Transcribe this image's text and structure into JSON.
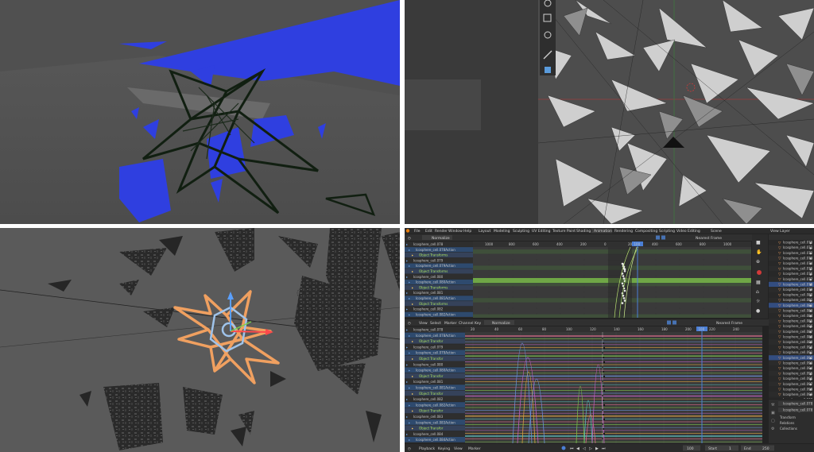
{
  "menu": [
    "File",
    "Edit",
    "Render",
    "Window",
    "Help"
  ],
  "workspaces": [
    "Layout",
    "Modeling",
    "Sculpting",
    "UV Editing",
    "Texture Paint",
    "Shading",
    "Animation",
    "Rendering",
    "Compositing",
    "Scripting",
    "Video Editing"
  ],
  "active_workspace": "Animation",
  "scene_name": "Scene",
  "view_layer": "View Layer",
  "normalize_label": "Normalize",
  "nearest_frame": "Nearest Frame",
  "graph_menu": [
    "View",
    "Select",
    "Marker",
    "Channel",
    "Key"
  ],
  "current_frame": "100",
  "dope_ticks": [
    "1000",
    "800",
    "600",
    "400",
    "200",
    "0",
    "200",
    "400",
    "600",
    "800",
    "1000"
  ],
  "graph_ticks": [
    "20",
    "40",
    "60",
    "80",
    "100",
    "120",
    "140",
    "160",
    "180",
    "200",
    "220",
    "240"
  ],
  "dope_channels": [
    {
      "label": "Icosphere_cell.078",
      "kind": "obj"
    },
    {
      "label": "Icosphere_cell.078Action",
      "kind": "act"
    },
    {
      "label": "Object Transforms",
      "kind": "grp"
    },
    {
      "label": "Icosphere_cell.079",
      "kind": "obj"
    },
    {
      "label": "Icosphere_cell.079Action",
      "kind": "act"
    },
    {
      "label": "Object Transforms",
      "kind": "grp"
    },
    {
      "label": "Icosphere_cell.080",
      "kind": "obj"
    },
    {
      "label": "Icosphere_cell.080Action",
      "kind": "act"
    },
    {
      "label": "Object Transforms",
      "kind": "grp"
    },
    {
      "label": "Icosphere_cell.081",
      "kind": "obj"
    },
    {
      "label": "Icosphere_cell.081Action",
      "kind": "act"
    },
    {
      "label": "Object Transforms",
      "kind": "grp"
    },
    {
      "label": "Icosphere_cell.082",
      "kind": "obj"
    },
    {
      "label": "Icosphere_cell.082Action",
      "kind": "act"
    }
  ],
  "graph_channels": [
    {
      "label": "Icosphere_cell.078",
      "kind": "obj"
    },
    {
      "label": "Icosphere_cell.078Action",
      "kind": "act"
    },
    {
      "label": "Object Transfor",
      "kind": "grp"
    },
    {
      "label": "Icosphere_cell.079",
      "kind": "obj"
    },
    {
      "label": "Icosphere_cell.079Action",
      "kind": "act"
    },
    {
      "label": "Object Transfor",
      "kind": "grp"
    },
    {
      "label": "Icosphere_cell.080",
      "kind": "obj"
    },
    {
      "label": "Icosphere_cell.080Action",
      "kind": "act"
    },
    {
      "label": "Object Transfor",
      "kind": "grp"
    },
    {
      "label": "Icosphere_cell.081",
      "kind": "obj"
    },
    {
      "label": "Icosphere_cell.081Action",
      "kind": "act"
    },
    {
      "label": "Object Transfor",
      "kind": "grp"
    },
    {
      "label": "Icosphere_cell.082",
      "kind": "obj"
    },
    {
      "label": "Icosphere_cell.082Action",
      "kind": "act"
    },
    {
      "label": "Object Transfor",
      "kind": "grp"
    },
    {
      "label": "Icosphere_cell.083",
      "kind": "obj"
    },
    {
      "label": "Icosphere_cell.083Action",
      "kind": "act"
    },
    {
      "label": "Object Transfor",
      "kind": "grp"
    },
    {
      "label": "Icosphere_cell.084",
      "kind": "obj"
    },
    {
      "label": "Icosphere_cell.084Action",
      "kind": "act"
    }
  ],
  "outliner_items": [
    "Icosphere_cell.070",
    "Icosphere_cell.071",
    "Icosphere_cell.072",
    "Icosphere_cell.073",
    "Icosphere_cell.074",
    "Icosphere_cell.075",
    "Icosphere_cell.076",
    "Icosphere_cell.077",
    "Icosphere_cell.078",
    "Icosphere_cell.079",
    "Icosphere_cell.080",
    "Icosphere_cell.081",
    "Icosphere_cell.082",
    "Icosphere_cell.083",
    "Icosphere_cell.084",
    "Icosphere_cell.085",
    "Icosphere_cell.086",
    "Icosphere_cell.087",
    "Icosphere_cell.088",
    "Icosphere_cell.089",
    "Icosphere_cell.090",
    "Icosphere_cell.091",
    "Icosphere_cell.092",
    "Icosphere_cell.093",
    "Icosphere_cell.094",
    "Icosphere_cell.095",
    "Icosphere_cell.096",
    "Icosphere_cell.097",
    "Icosphere_cell.098",
    "Icosphere_cell.099",
    "Icosphere_cell.100"
  ],
  "props_object": "Icosphere_cell.078",
  "props_sections": [
    "Transform",
    "Relations",
    "Collections"
  ],
  "playback": {
    "playback_label": "Playback",
    "keying_label": "Keying",
    "view_label": "View",
    "marker_label": "Marker",
    "frame": "100",
    "start_label": "Start",
    "start": "1",
    "end_label": "End",
    "end": "250"
  },
  "colors": {
    "accent": "#4772b3",
    "blue_fragments": "#2f3fe0",
    "selection_orange": "#f0a060",
    "keyframe": "#e8e8e8",
    "playhead": "#4b7fd6"
  }
}
